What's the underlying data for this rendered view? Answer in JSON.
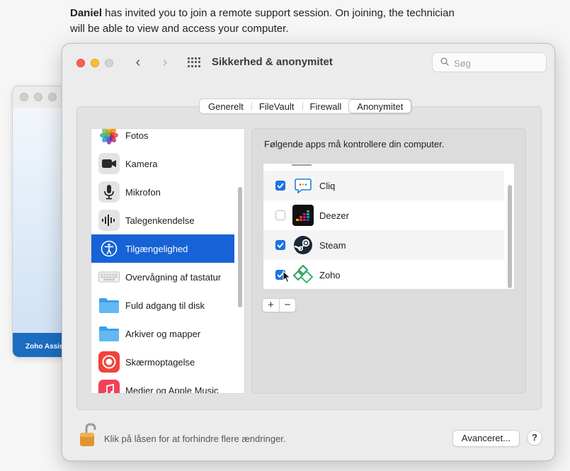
{
  "intro": {
    "name": "Daniel",
    "line1": " has invited you to join a remote support session. On joining, the technician",
    "line2": "will be able to view and access your computer."
  },
  "background_window": {
    "footer_label": "Zoho Assis"
  },
  "window": {
    "title": "Sikkerhed & anonymitet",
    "nav_back": "‹",
    "nav_forward": "›",
    "search_placeholder": "Søg"
  },
  "tabs": [
    {
      "label": "Generelt",
      "active": false
    },
    {
      "label": "FileVault",
      "active": false
    },
    {
      "label": "Firewall",
      "active": false
    },
    {
      "label": "Anonymitet",
      "active": true
    }
  ],
  "sidebar": {
    "items": [
      {
        "label": "Fotos",
        "icon": "photos-icon"
      },
      {
        "label": "Kamera",
        "icon": "camera-icon"
      },
      {
        "label": "Mikrofon",
        "icon": "microphone-icon"
      },
      {
        "label": "Talegenkendelse",
        "icon": "speech-recognition-icon"
      },
      {
        "label": "Tilgængelighed",
        "icon": "accessibility-icon",
        "selected": true
      },
      {
        "label": "Overvågning af tastatur",
        "icon": "keyboard-icon"
      },
      {
        "label": "Fuld adgang til disk",
        "icon": "folder-icon"
      },
      {
        "label": "Arkiver og mapper",
        "icon": "folder-icon"
      },
      {
        "label": "Skærmoptagelse",
        "icon": "screen-recording-icon"
      },
      {
        "label": "Medier og Apple Music",
        "icon": "music-icon"
      }
    ]
  },
  "right_panel": {
    "title": "Følgende apps må kontrollere din computer.",
    "apps": [
      {
        "label": "Cliq",
        "checked": true,
        "icon": "cliq-icon"
      },
      {
        "label": "Deezer",
        "checked": false,
        "icon": "deezer-icon"
      },
      {
        "label": "Steam",
        "checked": true,
        "icon": "steam-icon"
      },
      {
        "label": "Zoho",
        "checked": true,
        "icon": "zoho-icon"
      }
    ],
    "add_label": "+",
    "remove_label": "−"
  },
  "footer": {
    "lock_text": "Klik på låsen for at forhindre flere ændringer.",
    "advanced_label": "Avanceret...",
    "help_label": "?"
  },
  "colors": {
    "selection": "#1662d6",
    "checkbox_on": "#1b74e8",
    "close": "#ff5f57",
    "minimize": "#febc2e"
  }
}
